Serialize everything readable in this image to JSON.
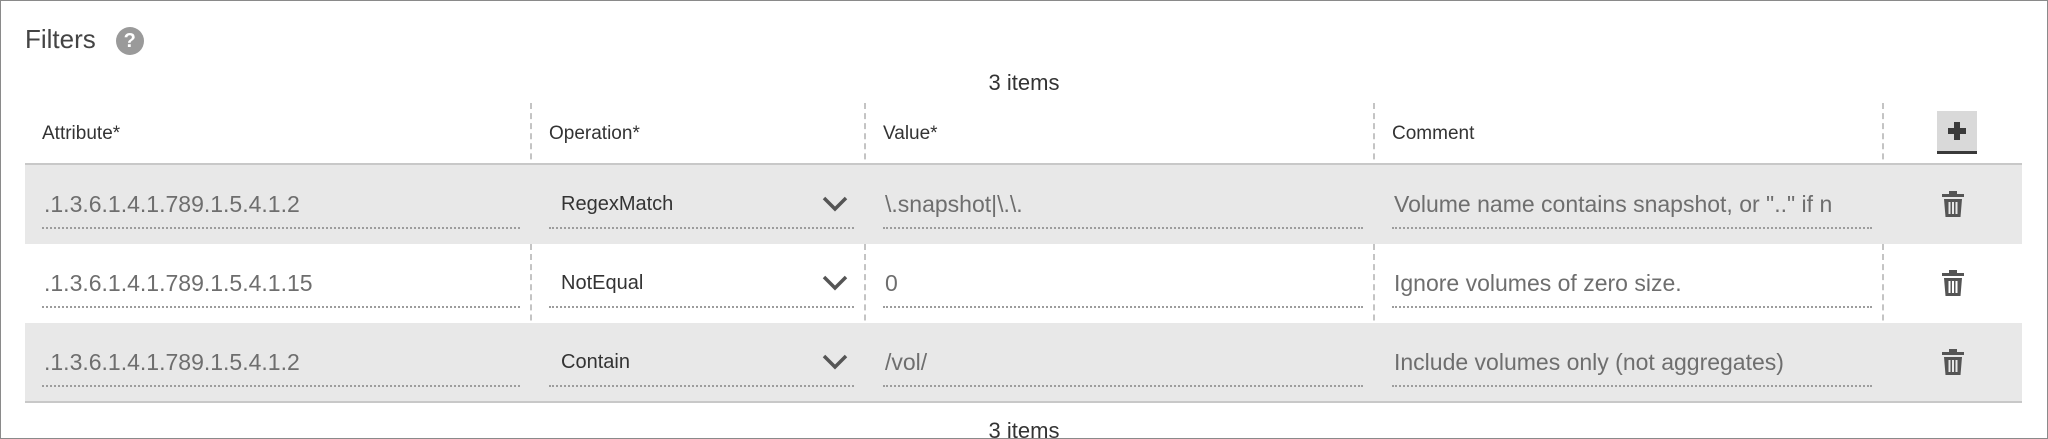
{
  "section": {
    "title": "Filters",
    "help_icon": "question-circle-icon"
  },
  "item_count_top": "3 items",
  "item_count_bottom": "3 items",
  "columns": [
    "Attribute*",
    "Operation*",
    "Value*",
    "Comment"
  ],
  "add_icon": "plus-icon",
  "rows": [
    {
      "attribute": ".1.3.6.1.4.1.789.1.5.4.1.2",
      "operation": "RegexMatch",
      "value": "\\.snapshot|\\.\\.",
      "comment": "Volume name contains snapshot, or \"..\" if n"
    },
    {
      "attribute": ".1.3.6.1.4.1.789.1.5.4.1.15",
      "operation": "NotEqual",
      "value": "0",
      "comment": "Ignore volumes of zero size."
    },
    {
      "attribute": ".1.3.6.1.4.1.789.1.5.4.1.2",
      "operation": "Contain",
      "value": "/vol/",
      "comment": "Include volumes only (not aggregates)"
    }
  ],
  "colors": {
    "row_shade": "#e8e8e8",
    "border": "#8a8a8a",
    "help_icon_bg": "#9a9a9a"
  }
}
